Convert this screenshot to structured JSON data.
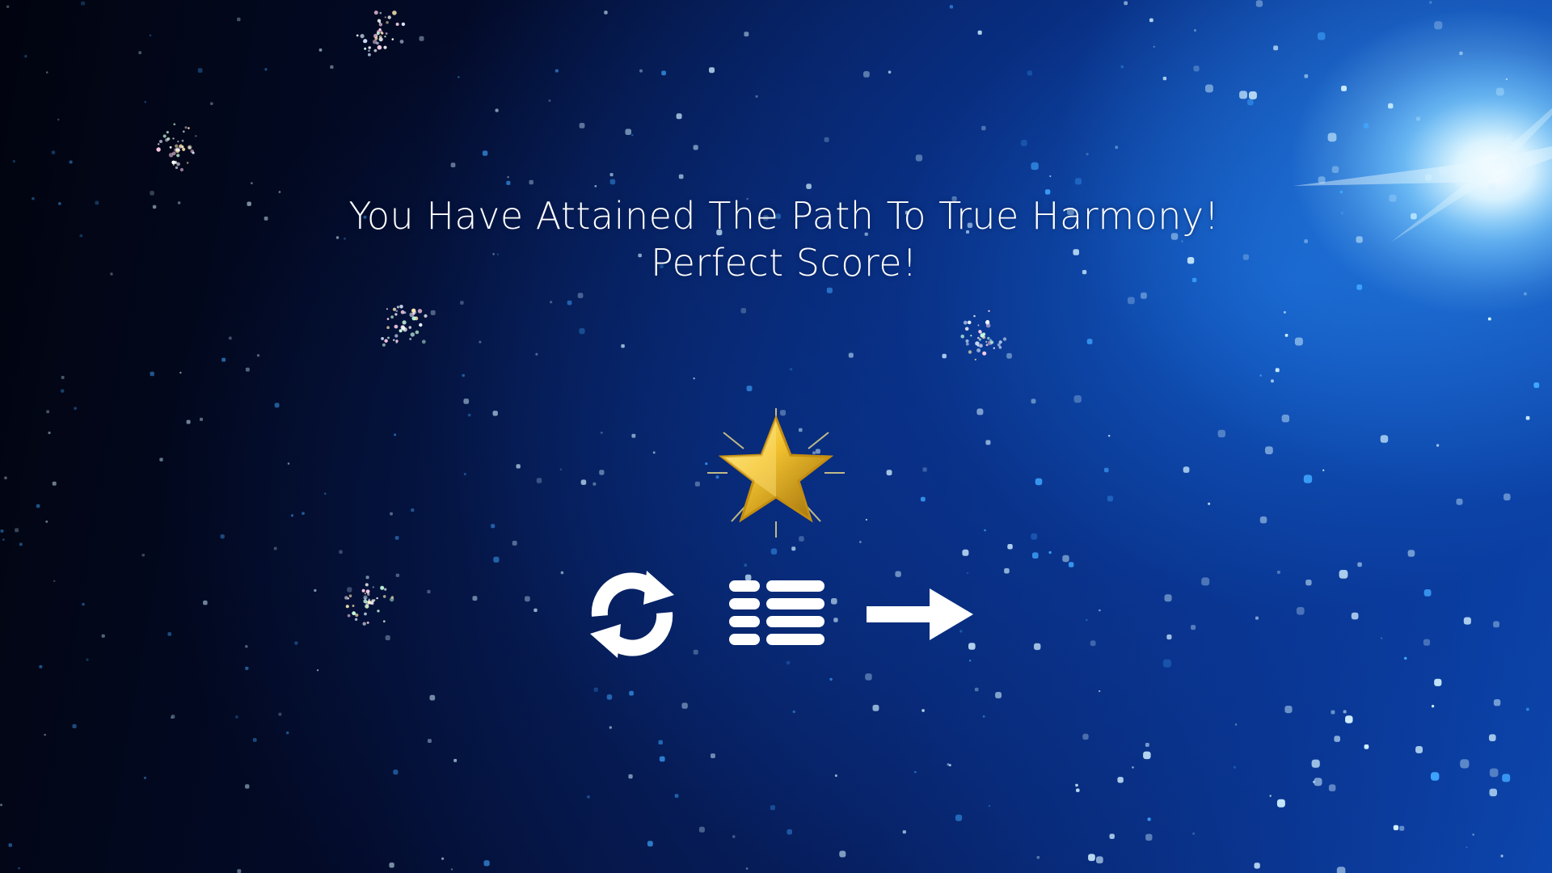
{
  "screen": {
    "title": "You Have Attained The Path To True Harmony!",
    "subtitle": "Perfect Score!"
  },
  "award": {
    "icon": "gold-star-icon",
    "color": "#f2c230"
  },
  "controls": [
    {
      "name": "retry-button",
      "icon": "restart-arrows-icon"
    },
    {
      "name": "level-menu-button",
      "icon": "list-menu-icon"
    },
    {
      "name": "next-level-button",
      "icon": "right-arrow-icon"
    }
  ],
  "colors": {
    "background_dark": "#020618",
    "background_glow": "#0d48b0",
    "text": "#ffffff",
    "star_gold": "#f2c230"
  }
}
